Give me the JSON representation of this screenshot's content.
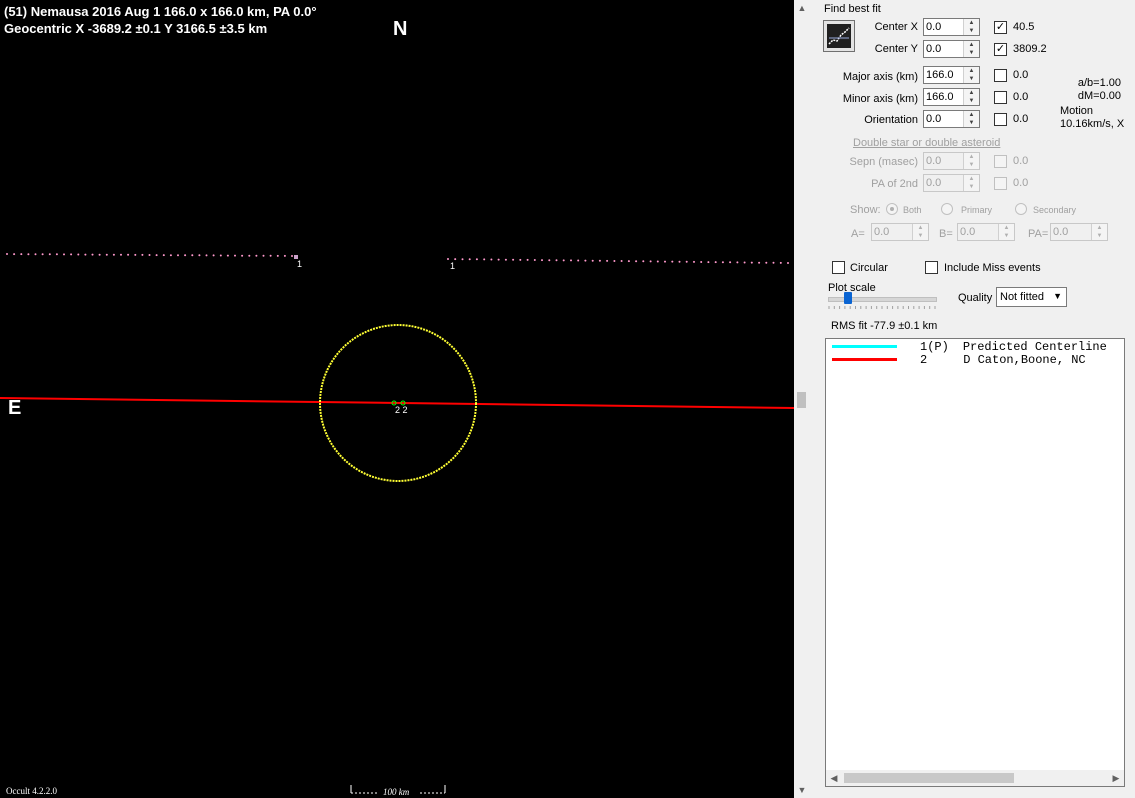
{
  "plot": {
    "title_line1": "(51) Nemausa  2016 Aug 1   166.0 x 166.0 km, PA 0.0°",
    "title_line2": "Geocentric  X  -3689.2 ±0.1  Y 3166.5 ±3.5 km",
    "north_label": "N",
    "east_label": "E",
    "chord1_label_left": "1",
    "chord1_label_right": "1",
    "chord2_labels": "2 2",
    "scale_bar_label": "100 km",
    "version": "Occult 4.2.2.0",
    "colors": {
      "background": "#000000",
      "ellipse": "#ffff33",
      "chord1": "#ff99cc",
      "chord2": "#ff0000"
    }
  },
  "panel": {
    "find_best_fit": "Find best fit",
    "fit_button_icon": "fit-ellipse-icon",
    "center_x": {
      "label": "Center X",
      "value": "0.0",
      "check_value": "40.5",
      "checked": true
    },
    "center_y": {
      "label": "Center Y",
      "value": "0.0",
      "check_value": "3809.2",
      "checked": true
    },
    "major_axis": {
      "label": "Major axis (km)",
      "value": "166.0",
      "check_value": "0.0",
      "checked": false
    },
    "minor_axis": {
      "label": "Minor axis (km)",
      "value": "166.0",
      "check_value": "0.0",
      "checked": false
    },
    "orientation": {
      "label": "Orientation",
      "value": "0.0",
      "check_value": "0.0",
      "checked": false
    },
    "ab_ratio": "a/b=1.00",
    "dm": "dM=0.00",
    "motion_label": "Motion",
    "motion_value": "10.16km/s, X",
    "double_star_link": "Double star  or  double asteroid",
    "sepn": {
      "label": "Sepn (masec)",
      "value": "0.0",
      "check_value": "0.0"
    },
    "pa2nd": {
      "label": "PA of 2nd",
      "value": "0.0",
      "check_value": "0.0"
    },
    "show_label": "Show:",
    "show_options": [
      "Both",
      "Primary",
      "Secondary"
    ],
    "a_label": "A=",
    "a_value": "0.0",
    "b_label": "B=",
    "b_value": "0.0",
    "pa_label": "PA=",
    "pa_value": "0.0",
    "circular_label": "Circular",
    "include_miss_label": "Include Miss events",
    "plot_scale_label": "Plot scale",
    "plot_scale_level": 0.15,
    "quality_label": "Quality",
    "quality_value": "Not fitted",
    "rms_fit": "RMS fit  -77.9 ±0.1 km",
    "legend": [
      {
        "num": "1(P)",
        "name": "Predicted Centerline",
        "color": "#00ffff"
      },
      {
        "num": "2",
        "name": "D Caton,Boone, NC",
        "color": "#ff0000"
      }
    ]
  }
}
